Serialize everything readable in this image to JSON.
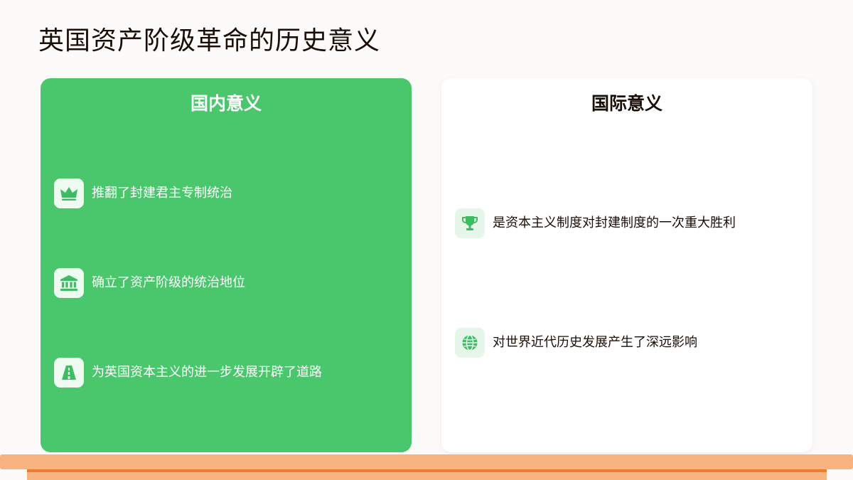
{
  "title": "英国资产阶级革命的历史意义",
  "colors": {
    "accent_green": "#4ac76c",
    "icon_green": "#3dbc62",
    "shelf_orange": "#f7b380",
    "shelf_line": "#ee7b2e",
    "text_dark": "#1a0e08"
  },
  "domestic": {
    "title": "国内意义",
    "items": [
      {
        "icon": "crown-icon",
        "text": "推翻了封建君主专制统治"
      },
      {
        "icon": "bank-icon",
        "text": "确立了资产阶级的统治地位"
      },
      {
        "icon": "road-icon",
        "text": "为英国资本主义的进一步发展开辟了道路"
      }
    ]
  },
  "international": {
    "title": "国际意义",
    "items": [
      {
        "icon": "trophy-icon",
        "text": "是资本主义制度对封建制度的一次重大胜利"
      },
      {
        "icon": "globe-icon",
        "text": "对世界近代历史发展产生了深远影响"
      }
    ]
  }
}
